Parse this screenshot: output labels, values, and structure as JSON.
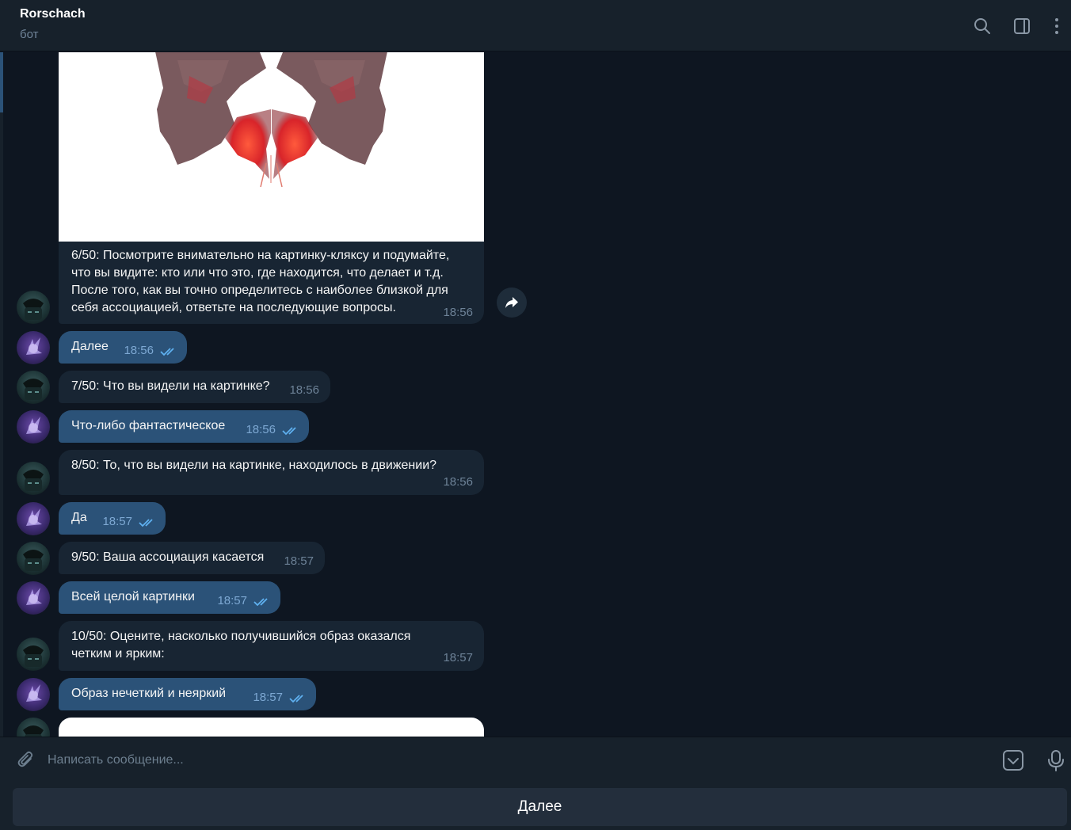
{
  "header": {
    "title": "Rorschach",
    "subtitle": "бот"
  },
  "messages": {
    "m6": {
      "text_lines": [
        "6/50: Посмотрите внимательно на картинку-кляксу и подумайте,",
        "что вы видите: кто или что это, где находится, что делает и т.д.",
        "После того, как вы точно определитесь с наиболее близкой для",
        "себя ассоциацией, ответьте на последующие вопросы."
      ],
      "time": "18:56"
    },
    "r6": {
      "text": "Далее",
      "time": "18:56"
    },
    "m7": {
      "text": "7/50: Что вы видели на картинке?",
      "time": "18:56"
    },
    "r7": {
      "text": "Что-либо фантастическое",
      "time": "18:56"
    },
    "m8": {
      "text": "8/50: То, что вы видели на картинке, находилось в движении?",
      "time": "18:56"
    },
    "r8": {
      "text": "Да",
      "time": "18:57"
    },
    "m9": {
      "text": "9/50: Ваша ассоциация касается",
      "time": "18:57"
    },
    "r9": {
      "text": "Всей целой картинки",
      "time": "18:57"
    },
    "m10": {
      "text_lines": [
        "10/50: Оцените, насколько получившийся образ оказался",
        "четким и ярким:"
      ],
      "time": "18:57"
    },
    "r10": {
      "text": "Образ нечеткий и неяркий",
      "time": "18:57"
    }
  },
  "composer": {
    "placeholder": "Написать сообщение..."
  },
  "keyboard": {
    "button_label": "Далее"
  },
  "colors": {
    "background": "#0e1621",
    "incoming_bubble": "#182533",
    "outgoing_bubble": "#2b5278",
    "read_check": "#5fb1f0"
  },
  "icons": {
    "search": "search-icon",
    "sidebar": "sidebar-toggle-icon",
    "menu": "more-vertical-icon",
    "share": "share-icon",
    "attach": "paperclip-icon",
    "bot_keyboard": "keyboard-icon",
    "mic": "microphone-icon",
    "read": "double-check-icon"
  }
}
